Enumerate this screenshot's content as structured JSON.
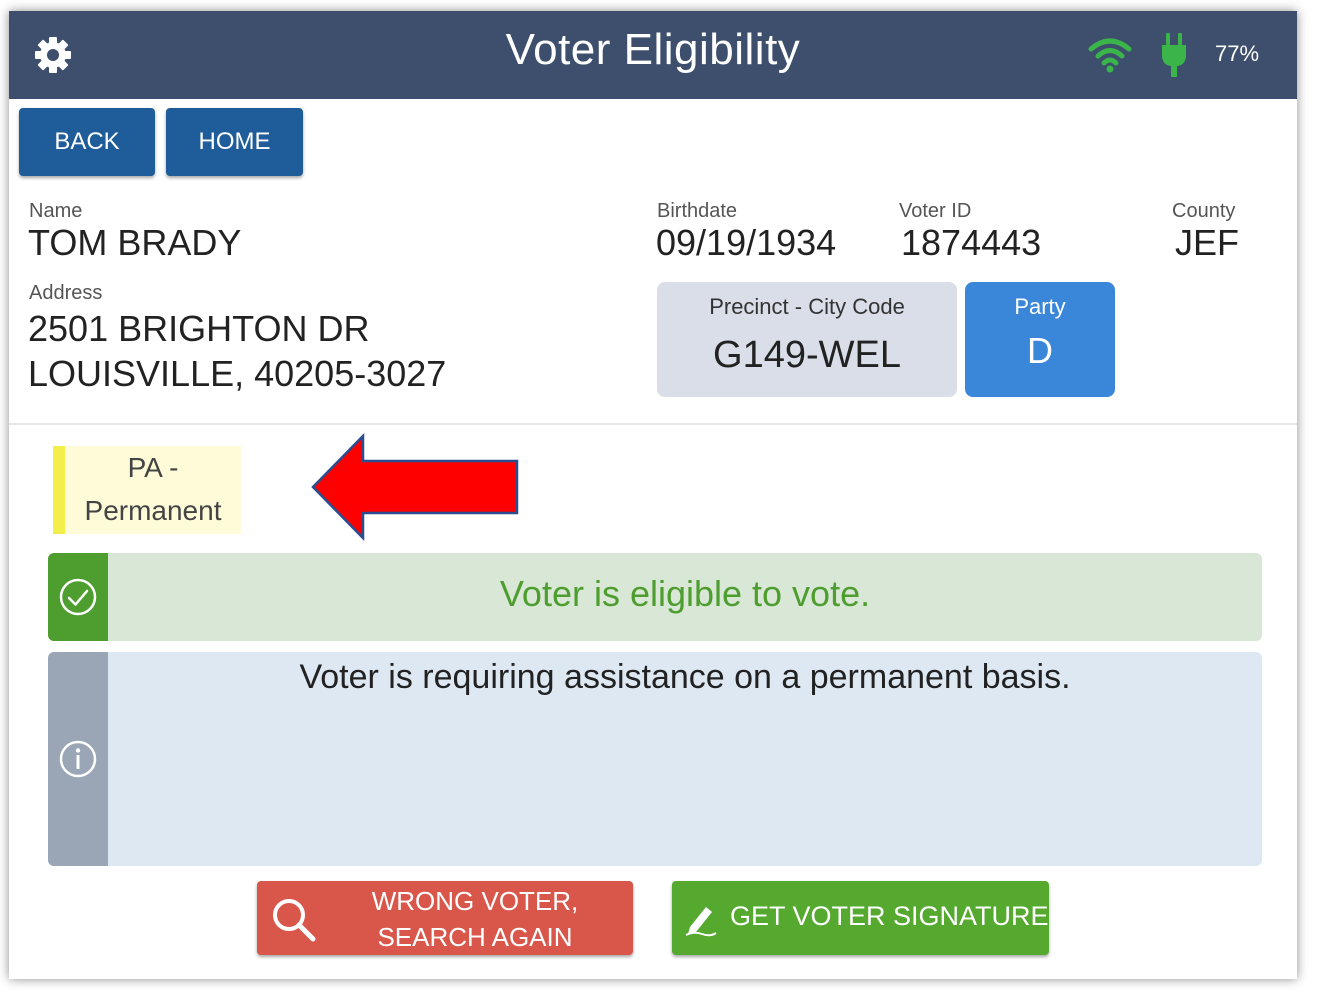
{
  "header": {
    "title": "Voter Eligibility",
    "battery_percent": "77%",
    "icons": [
      "gear-icon",
      "wifi-icon",
      "power-plug-icon"
    ],
    "accent_color": "#3d4f6d",
    "status_icon_color": "#3bb44a"
  },
  "nav": {
    "back_label": "BACK",
    "home_label": "HOME"
  },
  "voter": {
    "name_label": "Name",
    "name": "TOM BRADY",
    "address_label": "Address",
    "address_line1": "2501 BRIGHTON DR",
    "address_line2": "LOUISVILLE, 40205-3027",
    "birthdate_label": "Birthdate",
    "birthdate": "09/19/1934",
    "voter_id_label": "Voter ID",
    "voter_id": "1874443",
    "county_label": "County",
    "county": "JEF",
    "precinct_label": "Precinct - City Code",
    "precinct": "G149-WEL",
    "party_label": "Party",
    "party": "D"
  },
  "tag": {
    "line1": "PA -",
    "line2": "Permanent"
  },
  "status": {
    "eligible_text": "Voter is eligible to vote.",
    "info_text": "Voter is requiring assistance on a permanent basis.",
    "eligible_color": "#4e9d2f"
  },
  "actions": {
    "wrong_voter_label": "WRONG VOTER,\nSEARCH AGAIN",
    "signature_label": "GET VOTER SIGNATURE"
  }
}
